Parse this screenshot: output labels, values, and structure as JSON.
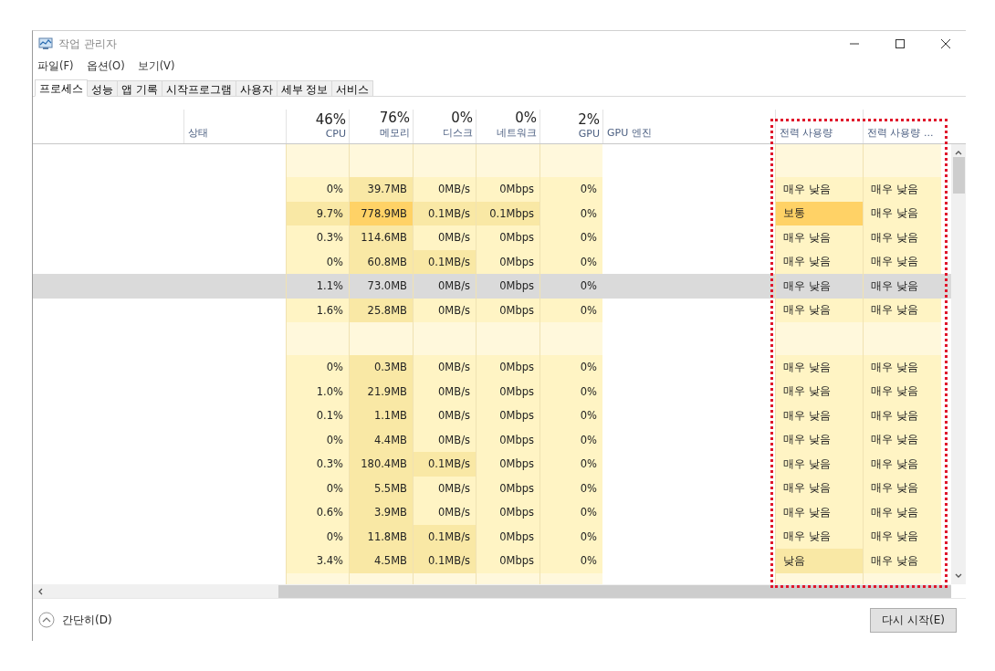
{
  "window": {
    "title": "작업 관리자"
  },
  "menu": [
    "파일(F)",
    "옵션(O)",
    "보기(V)"
  ],
  "tabs": [
    {
      "label": "프로세스",
      "selected": true
    },
    {
      "label": "성능",
      "selected": false
    },
    {
      "label": "앱 기록",
      "selected": false
    },
    {
      "label": "시작프로그램",
      "selected": false
    },
    {
      "label": "사용자",
      "selected": false
    },
    {
      "label": "세부 정보",
      "selected": false
    },
    {
      "label": "서비스",
      "selected": false
    }
  ],
  "columns": [
    {
      "label": "상태",
      "kind": "plain"
    },
    {
      "label": "CPU",
      "percent": "46%",
      "kind": "metric"
    },
    {
      "label": "메모리",
      "percent": "76%",
      "kind": "metric"
    },
    {
      "label": "디스크",
      "percent": "0%",
      "kind": "metric"
    },
    {
      "label": "네트워크",
      "percent": "0%",
      "kind": "metric"
    },
    {
      "label": "GPU",
      "percent": "2%",
      "kind": "metric"
    },
    {
      "label": "GPU 엔진",
      "kind": "plain"
    },
    {
      "label": "전력 사용량",
      "kind": "rating"
    },
    {
      "label": "전력 사용량 ...",
      "kind": "rating"
    }
  ],
  "rows": [
    {
      "kind": "group"
    },
    {
      "kind": "process",
      "selected": false,
      "cells": [
        {
          "text": "0%",
          "color": "#fff4c4"
        },
        {
          "text": "39.7MB",
          "color": "#f9e8a5"
        },
        {
          "text": "0MB/s",
          "color": "#fff4c4"
        },
        {
          "text": "0Mbps",
          "color": "#fff4c4"
        },
        {
          "text": "0%",
          "color": "#fff4c4"
        },
        {
          "text": "매우 낮음",
          "color": "#fff4c4"
        },
        {
          "text": "매우 낮음",
          "color": "#fff4c4"
        }
      ]
    },
    {
      "kind": "process",
      "selected": false,
      "cells": [
        {
          "text": "9.7%",
          "color": "#f9e8a5"
        },
        {
          "text": "778.9MB",
          "color": "#ffd266"
        },
        {
          "text": "0.1MB/s",
          "color": "#f9e8a5"
        },
        {
          "text": "0.1Mbps",
          "color": "#f9e8a5"
        },
        {
          "text": "0%",
          "color": "#fff4c4"
        },
        {
          "text": "보통",
          "color": "#ffd266"
        },
        {
          "text": "매우 낮음",
          "color": "#fff4c4"
        }
      ]
    },
    {
      "kind": "process",
      "selected": false,
      "cells": [
        {
          "text": "0.3%",
          "color": "#fff4c4"
        },
        {
          "text": "114.6MB",
          "color": "#f9e8a5"
        },
        {
          "text": "0MB/s",
          "color": "#fff4c4"
        },
        {
          "text": "0Mbps",
          "color": "#fff4c4"
        },
        {
          "text": "0%",
          "color": "#fff4c4"
        },
        {
          "text": "매우 낮음",
          "color": "#fff4c4"
        },
        {
          "text": "매우 낮음",
          "color": "#fff4c4"
        }
      ]
    },
    {
      "kind": "process",
      "selected": false,
      "cells": [
        {
          "text": "0%",
          "color": "#fff4c4"
        },
        {
          "text": "60.8MB",
          "color": "#f9e8a5"
        },
        {
          "text": "0.1MB/s",
          "color": "#f9e8a5"
        },
        {
          "text": "0Mbps",
          "color": "#fff4c4"
        },
        {
          "text": "0%",
          "color": "#fff4c4"
        },
        {
          "text": "매우 낮음",
          "color": "#fff4c4"
        },
        {
          "text": "매우 낮음",
          "color": "#fff4c4"
        }
      ]
    },
    {
      "kind": "process",
      "selected": true,
      "cells": [
        {
          "text": "1.1%",
          "color": "#dadada"
        },
        {
          "text": "73.0MB",
          "color": "#dadada"
        },
        {
          "text": "0MB/s",
          "color": "#dadada"
        },
        {
          "text": "0Mbps",
          "color": "#dadada"
        },
        {
          "text": "0%",
          "color": "#dadada"
        },
        {
          "text": "매우 낮음",
          "color": "#dadada"
        },
        {
          "text": "매우 낮음",
          "color": "#dadada"
        }
      ]
    },
    {
      "kind": "process",
      "selected": false,
      "cells": [
        {
          "text": "1.6%",
          "color": "#fff4c4"
        },
        {
          "text": "25.8MB",
          "color": "#f9e8a5"
        },
        {
          "text": "0MB/s",
          "color": "#fff4c4"
        },
        {
          "text": "0Mbps",
          "color": "#fff4c4"
        },
        {
          "text": "0%",
          "color": "#fff4c4"
        },
        {
          "text": "매우 낮음",
          "color": "#fff4c4"
        },
        {
          "text": "매우 낮음",
          "color": "#fff4c4"
        }
      ]
    },
    {
      "kind": "group"
    },
    {
      "kind": "process",
      "selected": false,
      "cells": [
        {
          "text": "0%",
          "color": "#fff4c4"
        },
        {
          "text": "0.3MB",
          "color": "#f9e8a5"
        },
        {
          "text": "0MB/s",
          "color": "#fff4c4"
        },
        {
          "text": "0Mbps",
          "color": "#fff4c4"
        },
        {
          "text": "0%",
          "color": "#fff4c4"
        },
        {
          "text": "매우 낮음",
          "color": "#fff4c4"
        },
        {
          "text": "매우 낮음",
          "color": "#fff4c4"
        }
      ]
    },
    {
      "kind": "process",
      "selected": false,
      "cells": [
        {
          "text": "1.0%",
          "color": "#fff4c4"
        },
        {
          "text": "21.9MB",
          "color": "#f9e8a5"
        },
        {
          "text": "0MB/s",
          "color": "#fff4c4"
        },
        {
          "text": "0Mbps",
          "color": "#fff4c4"
        },
        {
          "text": "0%",
          "color": "#fff4c4"
        },
        {
          "text": "매우 낮음",
          "color": "#fff4c4"
        },
        {
          "text": "매우 낮음",
          "color": "#fff4c4"
        }
      ]
    },
    {
      "kind": "process",
      "selected": false,
      "cells": [
        {
          "text": "0.1%",
          "color": "#fff4c4"
        },
        {
          "text": "1.1MB",
          "color": "#f9e8a5"
        },
        {
          "text": "0MB/s",
          "color": "#fff4c4"
        },
        {
          "text": "0Mbps",
          "color": "#fff4c4"
        },
        {
          "text": "0%",
          "color": "#fff4c4"
        },
        {
          "text": "매우 낮음",
          "color": "#fff4c4"
        },
        {
          "text": "매우 낮음",
          "color": "#fff4c4"
        }
      ]
    },
    {
      "kind": "process",
      "selected": false,
      "cells": [
        {
          "text": "0%",
          "color": "#fff4c4"
        },
        {
          "text": "4.4MB",
          "color": "#f9e8a5"
        },
        {
          "text": "0MB/s",
          "color": "#fff4c4"
        },
        {
          "text": "0Mbps",
          "color": "#fff4c4"
        },
        {
          "text": "0%",
          "color": "#fff4c4"
        },
        {
          "text": "매우 낮음",
          "color": "#fff4c4"
        },
        {
          "text": "매우 낮음",
          "color": "#fff4c4"
        }
      ]
    },
    {
      "kind": "process",
      "selected": false,
      "cells": [
        {
          "text": "0.3%",
          "color": "#fff4c4"
        },
        {
          "text": "180.4MB",
          "color": "#f9e8a5"
        },
        {
          "text": "0.1MB/s",
          "color": "#f9e8a5"
        },
        {
          "text": "0Mbps",
          "color": "#fff4c4"
        },
        {
          "text": "0%",
          "color": "#fff4c4"
        },
        {
          "text": "매우 낮음",
          "color": "#fff4c4"
        },
        {
          "text": "매우 낮음",
          "color": "#fff4c4"
        }
      ]
    },
    {
      "kind": "process",
      "selected": false,
      "cells": [
        {
          "text": "0%",
          "color": "#fff4c4"
        },
        {
          "text": "5.5MB",
          "color": "#f9e8a5"
        },
        {
          "text": "0MB/s",
          "color": "#fff4c4"
        },
        {
          "text": "0Mbps",
          "color": "#fff4c4"
        },
        {
          "text": "0%",
          "color": "#fff4c4"
        },
        {
          "text": "매우 낮음",
          "color": "#fff4c4"
        },
        {
          "text": "매우 낮음",
          "color": "#fff4c4"
        }
      ]
    },
    {
      "kind": "process",
      "selected": false,
      "cells": [
        {
          "text": "0.6%",
          "color": "#fff4c4"
        },
        {
          "text": "3.9MB",
          "color": "#f9e8a5"
        },
        {
          "text": "0MB/s",
          "color": "#fff4c4"
        },
        {
          "text": "0Mbps",
          "color": "#fff4c4"
        },
        {
          "text": "0%",
          "color": "#fff4c4"
        },
        {
          "text": "매우 낮음",
          "color": "#fff4c4"
        },
        {
          "text": "매우 낮음",
          "color": "#fff4c4"
        }
      ]
    },
    {
      "kind": "process",
      "selected": false,
      "cells": [
        {
          "text": "0%",
          "color": "#fff4c4"
        },
        {
          "text": "11.8MB",
          "color": "#f9e8a5"
        },
        {
          "text": "0.1MB/s",
          "color": "#f9e8a5"
        },
        {
          "text": "0Mbps",
          "color": "#fff4c4"
        },
        {
          "text": "0%",
          "color": "#fff4c4"
        },
        {
          "text": "매우 낮음",
          "color": "#fff4c4"
        },
        {
          "text": "매우 낮음",
          "color": "#fff4c4"
        }
      ]
    },
    {
      "kind": "process",
      "selected": false,
      "cells": [
        {
          "text": "3.4%",
          "color": "#fff4c4"
        },
        {
          "text": "4.5MB",
          "color": "#f9e8a5"
        },
        {
          "text": "0.1MB/s",
          "color": "#f9e8a5"
        },
        {
          "text": "0Mbps",
          "color": "#fff4c4"
        },
        {
          "text": "0%",
          "color": "#fff4c4"
        },
        {
          "text": "낮음",
          "color": "#f9e8a5"
        },
        {
          "text": "매우 낮음",
          "color": "#fff4c4"
        }
      ]
    },
    {
      "kind": "group"
    }
  ],
  "footer": {
    "collapse": "간단히(D)",
    "button": "다시 시작(E)"
  }
}
